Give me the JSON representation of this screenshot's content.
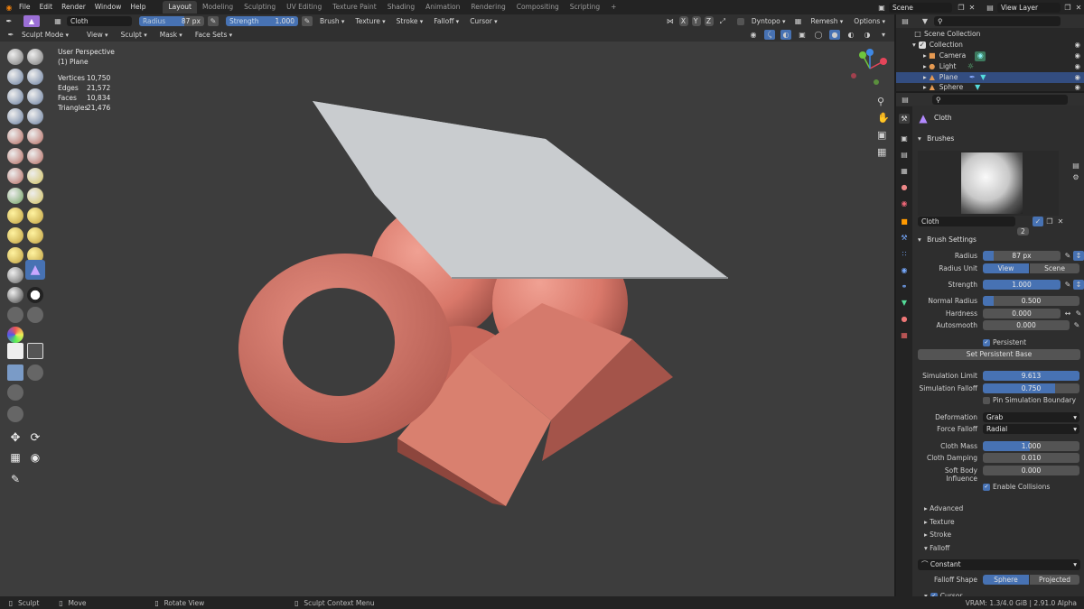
{
  "topbar": {
    "menus": [
      "File",
      "Edit",
      "Render",
      "Window",
      "Help"
    ],
    "workspaces": [
      "Layout",
      "Modeling",
      "Sculpting",
      "UV Editing",
      "Texture Paint",
      "Shading",
      "Animation",
      "Rendering",
      "Compositing",
      "Scripting"
    ],
    "active_workspace": "Layout",
    "add_tab": "+",
    "scene": "Scene",
    "view_layer": "View Layer"
  },
  "toolhdr": {
    "brush_name": "Cloth",
    "radius_label": "Radius",
    "radius_value": "87 px",
    "strength_label": "Strength",
    "strength_value": "1.000",
    "menus": [
      "Brush",
      "Texture",
      "Stroke",
      "Falloff",
      "Cursor"
    ],
    "axes": [
      "X",
      "Y",
      "Z"
    ],
    "dyntopo": "Dyntopo",
    "remesh": "Remesh",
    "options": "Options"
  },
  "modehdr": {
    "mode": "Sculpt Mode",
    "menus": [
      "View",
      "Sculpt",
      "Mask",
      "Face Sets"
    ]
  },
  "viewport": {
    "perspective": "User Perspective",
    "object": "(1) Plane",
    "stats": [
      {
        "label": "Vertices",
        "value": "10,750"
      },
      {
        "label": "Edges",
        "value": "21,572"
      },
      {
        "label": "Faces",
        "value": "10,834"
      },
      {
        "label": "Triangles",
        "value": "21,476"
      }
    ],
    "colors": {
      "bg": "#3d3d3d",
      "clay": "#d9786a",
      "clay_dark": "#a9544a",
      "cloth": "#c9cccf"
    }
  },
  "outliner": {
    "title": "Scene Collection",
    "collection": "Collection",
    "items": [
      "Camera",
      "Light",
      "Plane",
      "Sphere"
    ],
    "selected": "Plane"
  },
  "props": {
    "tool_name": "Cloth",
    "brushes_title": "Brushes",
    "brush_field": "Cloth",
    "brush_users": "2",
    "brush_settings_title": "Brush Settings",
    "radius_label": "Radius",
    "radius_value": "87 px",
    "radius_unit_label": "Radius Unit",
    "radius_unit_options": [
      "View",
      "Scene"
    ],
    "strength_label": "Strength",
    "strength_value": "1.000",
    "normal_radius_label": "Normal Radius",
    "normal_radius_value": "0.500",
    "normal_radius_fraction": 0.5,
    "hardness_label": "Hardness",
    "hardness_value": "0.000",
    "autosmooth_label": "Autosmooth",
    "autosmooth_value": "0.000",
    "persistent_label": "Persistent",
    "set_persistent_base": "Set Persistent Base",
    "sim_limit_label": "Simulation Limit",
    "sim_limit_value": "9.613",
    "sim_falloff_label": "Simulation Falloff",
    "sim_falloff_value": "0.750",
    "sim_falloff_fraction": 0.75,
    "pin_boundary_label": "Pin Simulation Boundary",
    "deformation_label": "Deformation",
    "deformation_value": "Grab",
    "force_falloff_label": "Force Falloff",
    "force_falloff_value": "Radial",
    "cloth_mass_label": "Cloth Mass",
    "cloth_mass_value": "1.000",
    "cloth_damping_label": "Cloth Damping",
    "cloth_damping_value": "0.010",
    "soft_body_label": "Soft Body Influence",
    "soft_body_value": "0.000",
    "enable_collisions_label": "Enable Collisions",
    "collapsed": [
      "Advanced",
      "Texture",
      "Stroke"
    ],
    "falloff_title": "Falloff",
    "falloff_preset": "Constant",
    "falloff_shape_label": "Falloff Shape",
    "falloff_shape_options": [
      "Sphere",
      "Projected"
    ],
    "cursor_label": "Cursor"
  },
  "statusbar": {
    "items": [
      "Sculpt",
      "Move",
      "Rotate View",
      "Sculpt Context Menu"
    ],
    "vram": "VRAM: 1.3/4.0 GiB | 2.91.0 Alpha"
  }
}
